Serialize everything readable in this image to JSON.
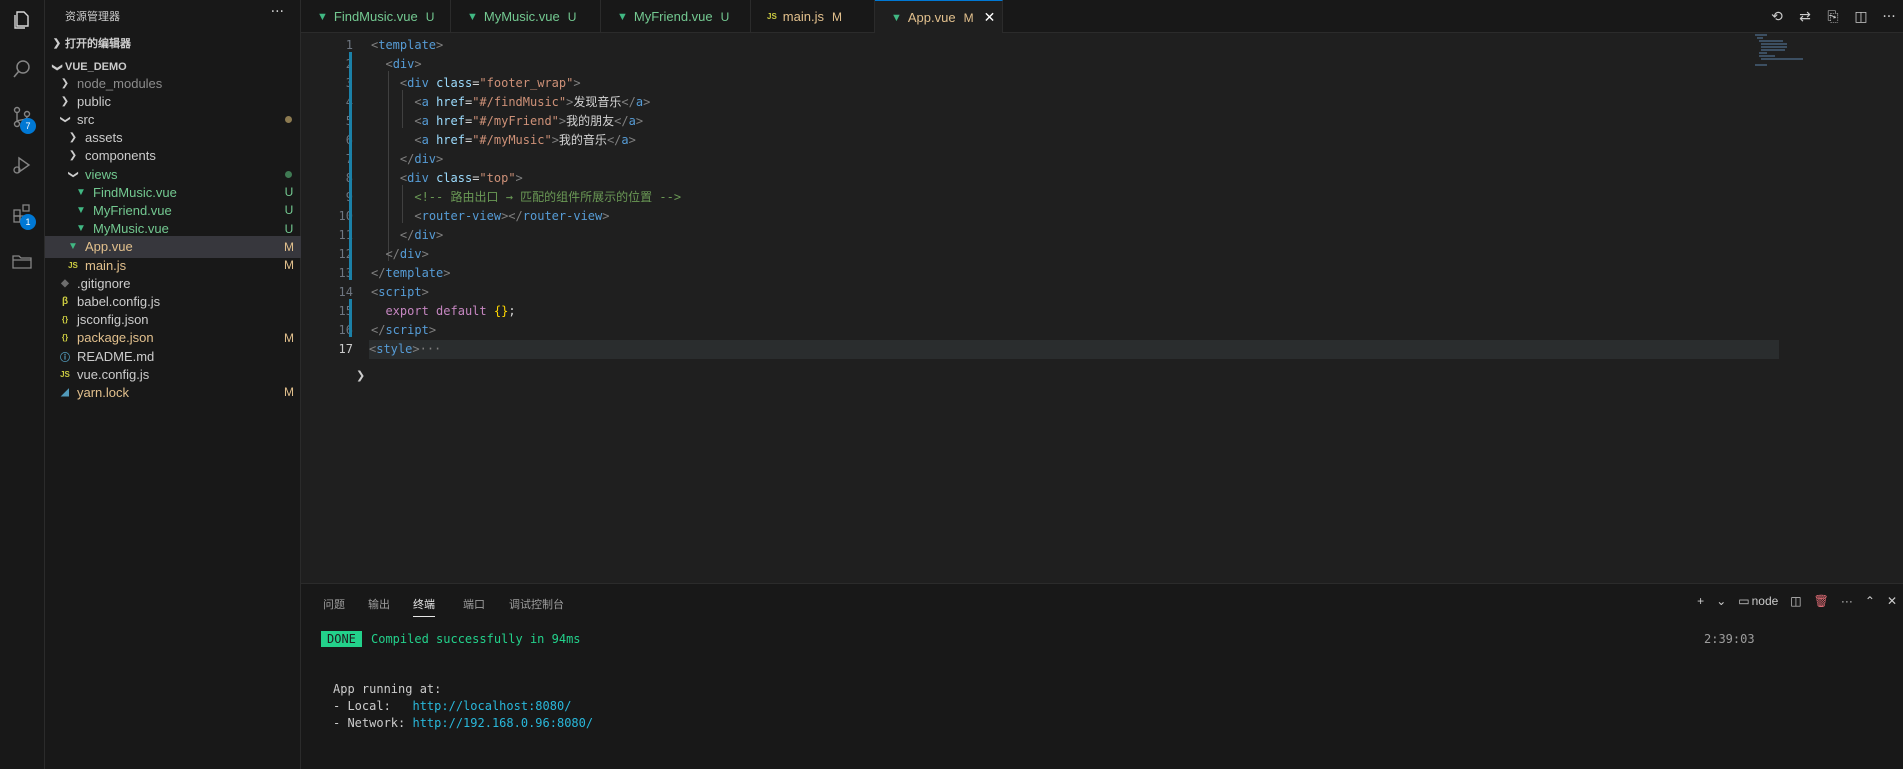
{
  "explorer": {
    "title": "资源管理器",
    "more": "···",
    "open_editors": "打开的编辑器",
    "project": "VUE_DEMO",
    "items": [
      {
        "name": "node_modules",
        "kind": "folder",
        "depth": 1,
        "expanded": false,
        "color": "#8c8c8c",
        "badge": ""
      },
      {
        "name": "public",
        "kind": "folder",
        "depth": 1,
        "expanded": false,
        "color": "#cccccc",
        "badge": ""
      },
      {
        "name": "src",
        "kind": "folder",
        "depth": 1,
        "expanded": true,
        "color": "#cccccc",
        "badge": "dot-mod"
      },
      {
        "name": "assets",
        "kind": "folder",
        "depth": 2,
        "expanded": false,
        "color": "#cccccc",
        "badge": ""
      },
      {
        "name": "components",
        "kind": "folder",
        "depth": 2,
        "expanded": false,
        "color": "#cccccc",
        "badge": ""
      },
      {
        "name": "views",
        "kind": "folder",
        "depth": 2,
        "expanded": true,
        "color": "#73c991",
        "badge": "dot-new"
      },
      {
        "name": "FindMusic.vue",
        "kind": "vue",
        "depth": 3,
        "color": "#73c991",
        "badge": "U"
      },
      {
        "name": "MyFriend.vue",
        "kind": "vue",
        "depth": 3,
        "color": "#73c991",
        "badge": "U"
      },
      {
        "name": "MyMusic.vue",
        "kind": "vue",
        "depth": 3,
        "color": "#73c991",
        "badge": "U"
      },
      {
        "name": "App.vue",
        "kind": "vue",
        "depth": 2,
        "color": "#e2c08d",
        "badge": "M",
        "selected": true
      },
      {
        "name": "main.js",
        "kind": "js",
        "depth": 2,
        "color": "#e2c08d",
        "badge": "M"
      },
      {
        "name": ".gitignore",
        "kind": "git",
        "depth": 1,
        "color": "#cccccc",
        "badge": ""
      },
      {
        "name": "babel.config.js",
        "kind": "babel",
        "depth": 1,
        "color": "#cccccc",
        "badge": ""
      },
      {
        "name": "jsconfig.json",
        "kind": "json",
        "depth": 1,
        "color": "#cccccc",
        "badge": ""
      },
      {
        "name": "package.json",
        "kind": "json",
        "depth": 1,
        "color": "#e2c08d",
        "badge": "M"
      },
      {
        "name": "README.md",
        "kind": "info",
        "depth": 1,
        "color": "#cccccc",
        "badge": ""
      },
      {
        "name": "vue.config.js",
        "kind": "js",
        "depth": 1,
        "color": "#cccccc",
        "badge": ""
      },
      {
        "name": "yarn.lock",
        "kind": "yarn",
        "depth": 1,
        "color": "#e2c08d",
        "badge": "M"
      }
    ]
  },
  "activity": {
    "scm_badge": "7",
    "ext_badge": "1"
  },
  "tabs": [
    {
      "name": "FindMusic.vue",
      "kind": "vue",
      "badge": "U",
      "color": "#73c991"
    },
    {
      "name": "MyMusic.vue",
      "kind": "vue",
      "badge": "U",
      "color": "#73c991"
    },
    {
      "name": "MyFriend.vue",
      "kind": "vue",
      "badge": "U",
      "color": "#73c991"
    },
    {
      "name": "main.js",
      "kind": "js",
      "badge": "M",
      "color": "#e2c08d"
    },
    {
      "name": "App.vue",
      "kind": "vue",
      "badge": "M",
      "color": "#e2c08d",
      "active": true
    }
  ],
  "editor": {
    "lines": [
      [
        [
          "t-punct",
          "<"
        ],
        [
          "t-tag",
          "template"
        ],
        [
          "t-punct",
          ">"
        ]
      ],
      [
        [
          "t-text",
          "  "
        ],
        [
          "t-punct",
          "<"
        ],
        [
          "t-tag",
          "div"
        ],
        [
          "t-punct",
          ">"
        ]
      ],
      [
        [
          "t-text",
          "    "
        ],
        [
          "t-punct",
          "<"
        ],
        [
          "t-tag",
          "div"
        ],
        [
          "t-text",
          " "
        ],
        [
          "t-attr",
          "class"
        ],
        [
          "t-text",
          "="
        ],
        [
          "t-str",
          "\"footer_wrap\""
        ],
        [
          "t-punct",
          ">"
        ]
      ],
      [
        [
          "t-text",
          "      "
        ],
        [
          "t-punct",
          "<"
        ],
        [
          "t-tag",
          "a"
        ],
        [
          "t-text",
          " "
        ],
        [
          "t-attr",
          "href"
        ],
        [
          "t-text",
          "="
        ],
        [
          "t-str",
          "\"#/findMusic\""
        ],
        [
          "t-punct",
          ">"
        ],
        [
          "t-text",
          "发现音乐"
        ],
        [
          "t-punct",
          "</"
        ],
        [
          "t-tag",
          "a"
        ],
        [
          "t-punct",
          ">"
        ]
      ],
      [
        [
          "t-text",
          "      "
        ],
        [
          "t-punct",
          "<"
        ],
        [
          "t-tag",
          "a"
        ],
        [
          "t-text",
          " "
        ],
        [
          "t-attr",
          "href"
        ],
        [
          "t-text",
          "="
        ],
        [
          "t-str",
          "\"#/myFriend\""
        ],
        [
          "t-punct",
          ">"
        ],
        [
          "t-text",
          "我的朋友"
        ],
        [
          "t-punct",
          "</"
        ],
        [
          "t-tag",
          "a"
        ],
        [
          "t-punct",
          ">"
        ]
      ],
      [
        [
          "t-text",
          "      "
        ],
        [
          "t-punct",
          "<"
        ],
        [
          "t-tag",
          "a"
        ],
        [
          "t-text",
          " "
        ],
        [
          "t-attr",
          "href"
        ],
        [
          "t-text",
          "="
        ],
        [
          "t-str",
          "\"#/myMusic\""
        ],
        [
          "t-punct",
          ">"
        ],
        [
          "t-text",
          "我的音乐"
        ],
        [
          "t-punct",
          "</"
        ],
        [
          "t-tag",
          "a"
        ],
        [
          "t-punct",
          ">"
        ]
      ],
      [
        [
          "t-text",
          "    "
        ],
        [
          "t-punct",
          "</"
        ],
        [
          "t-tag",
          "div"
        ],
        [
          "t-punct",
          ">"
        ]
      ],
      [
        [
          "t-text",
          "    "
        ],
        [
          "t-punct",
          "<"
        ],
        [
          "t-tag",
          "div"
        ],
        [
          "t-text",
          " "
        ],
        [
          "t-attr",
          "class"
        ],
        [
          "t-text",
          "="
        ],
        [
          "t-str",
          "\"top\""
        ],
        [
          "t-punct",
          ">"
        ]
      ],
      [
        [
          "t-text",
          "      "
        ],
        [
          "t-comment",
          "<!-- 路由出口 → 匹配的组件所展示的位置 -->"
        ]
      ],
      [
        [
          "t-text",
          "      "
        ],
        [
          "t-punct",
          "<"
        ],
        [
          "t-tag",
          "router-view"
        ],
        [
          "t-punct",
          "></"
        ],
        [
          "t-tag",
          "router-view"
        ],
        [
          "t-punct",
          ">"
        ]
      ],
      [
        [
          "t-text",
          "    "
        ],
        [
          "t-punct",
          "</"
        ],
        [
          "t-tag",
          "div"
        ],
        [
          "t-punct",
          ">"
        ]
      ],
      [
        [
          "t-text",
          "  "
        ],
        [
          "t-punct",
          "</"
        ],
        [
          "t-tag",
          "div"
        ],
        [
          "t-punct",
          ">"
        ]
      ],
      [
        [
          "t-punct",
          "</"
        ],
        [
          "t-tag",
          "template"
        ],
        [
          "t-punct",
          ">"
        ]
      ],
      [
        [
          "t-punct",
          "<"
        ],
        [
          "t-tag",
          "script"
        ],
        [
          "t-punct",
          ">"
        ]
      ],
      [
        [
          "t-text",
          "  "
        ],
        [
          "t-kw",
          "export"
        ],
        [
          "t-text",
          " "
        ],
        [
          "t-kw",
          "default"
        ],
        [
          "t-text",
          " "
        ],
        [
          "t-brace",
          "{}"
        ],
        [
          "t-text",
          ";"
        ]
      ],
      [
        [
          "t-punct",
          "</"
        ],
        [
          "t-tag",
          "script"
        ],
        [
          "t-punct",
          ">"
        ]
      ],
      [
        [
          "t-punct",
          "<"
        ],
        [
          "t-tag",
          "style"
        ],
        [
          "t-punct",
          ">"
        ],
        [
          "t-punct",
          "···"
        ]
      ]
    ],
    "current_line": 17
  },
  "panel": {
    "tabs": [
      "问题",
      "输出",
      "终端",
      "端口",
      "调试控制台"
    ],
    "active_tab": 2,
    "shell": "node",
    "add": "+",
    "done": "DONE",
    "compiled": "Compiled successfully in 94ms",
    "time": "2:39:03",
    "running": "App running at:",
    "local_label": "- Local:   ",
    "local_url": "http://localhost:8080/",
    "network_label": "- Network: ",
    "network_url": "http://192.168.0.96:8080/"
  }
}
